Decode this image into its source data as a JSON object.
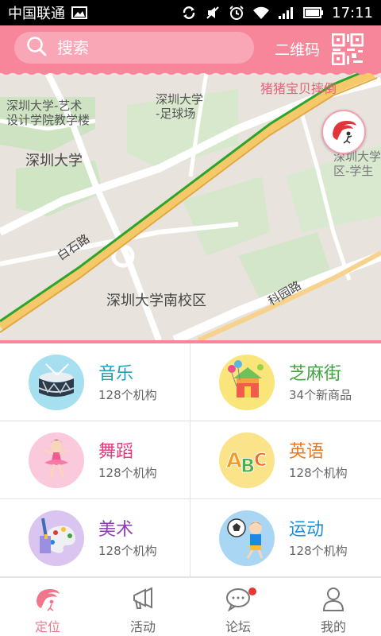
{
  "status_bar": {
    "carrier": "中国联通",
    "time": "17:11"
  },
  "header": {
    "search_placeholder": "搜索",
    "qr_label": "二维码"
  },
  "map": {
    "banner": "猪猪宝贝摔倒",
    "labels": {
      "art_school": "深圳大学-艺术\n设计学院教学楼",
      "football": "深圳大学\n-足球场",
      "shenda": "深圳大学",
      "south_campus": "深圳大学南校区",
      "baishi_road": "白石路",
      "keyuan_road": "科园路",
      "right_partial": "深圳大学\n区-学生"
    }
  },
  "categories": [
    {
      "title": "音乐",
      "subtitle": "128个机构",
      "title_color": "#1aa3b8",
      "icon": "drum-icon"
    },
    {
      "title": "芝麻街",
      "subtitle": "34个新商品",
      "title_color": "#43a443",
      "icon": "gift-house-icon"
    },
    {
      "title": "舞蹈",
      "subtitle": "128个机构",
      "title_color": "#e5397e",
      "icon": "ballerina-icon"
    },
    {
      "title": "英语",
      "subtitle": "128个机构",
      "title_color": "#f0781e",
      "icon": "abc-icon"
    },
    {
      "title": "美术",
      "subtitle": "128个机构",
      "title_color": "#8e3fb5",
      "icon": "paint-palette-icon"
    },
    {
      "title": "运动",
      "subtitle": "128个机构",
      "title_color": "#1a8fd6",
      "icon": "soccer-kid-icon"
    }
  ],
  "tabs": [
    {
      "label": "定位",
      "active": true
    },
    {
      "label": "活动",
      "active": false
    },
    {
      "label": "论坛",
      "active": false
    },
    {
      "label": "我的",
      "active": false
    }
  ],
  "colors": {
    "accent": "#f7869b",
    "accent_text": "#f0768c"
  }
}
